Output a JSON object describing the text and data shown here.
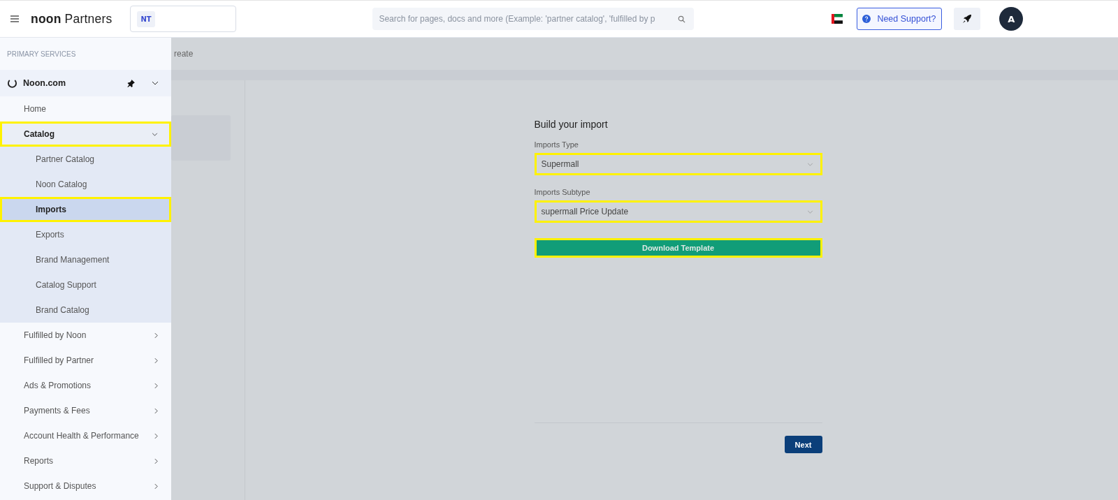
{
  "header": {
    "logo": {
      "brand": "noon",
      "product": "Partners"
    },
    "store_badge": "NT",
    "search": {
      "placeholder": "Search for pages, docs and more (Example: 'partner catalog', 'fulfilled by p"
    },
    "support_button": "Need Support?",
    "avatar": "A"
  },
  "breadcrumb": "reate",
  "sidebar": {
    "section": "PRIMARY SERVICES",
    "service": {
      "label": "Noon.com",
      "expanded": true
    },
    "items": [
      {
        "label": "Home",
        "kind": "link",
        "highlighted": false
      },
      {
        "label": "Catalog",
        "kind": "group",
        "expanded": true,
        "highlighted": true,
        "children": [
          {
            "label": "Partner Catalog",
            "selected": false,
            "highlighted": false
          },
          {
            "label": "Noon Catalog",
            "selected": false,
            "highlighted": false
          },
          {
            "label": "Imports",
            "selected": true,
            "highlighted": true
          },
          {
            "label": "Exports",
            "selected": false,
            "highlighted": false
          },
          {
            "label": "Brand Management",
            "selected": false,
            "highlighted": false
          },
          {
            "label": "Catalog Support",
            "selected": false,
            "highlighted": false
          },
          {
            "label": "Brand Catalog",
            "selected": false,
            "highlighted": false
          }
        ]
      },
      {
        "label": "Fulfilled by Noon",
        "kind": "group",
        "expanded": false,
        "highlighted": false
      },
      {
        "label": "Fulfilled by Partner",
        "kind": "group",
        "expanded": false,
        "highlighted": false
      },
      {
        "label": "Ads & Promotions",
        "kind": "group",
        "expanded": false,
        "highlighted": false
      },
      {
        "label": "Payments & Fees",
        "kind": "group",
        "expanded": false,
        "highlighted": false
      },
      {
        "label": "Account Health & Performance",
        "kind": "group",
        "expanded": false,
        "highlighted": false
      },
      {
        "label": "Reports",
        "kind": "group",
        "expanded": false,
        "highlighted": false
      },
      {
        "label": "Support & Disputes",
        "kind": "group",
        "expanded": false,
        "highlighted": false
      }
    ]
  },
  "form": {
    "title": "Build your import",
    "fields": [
      {
        "label": "Imports Type",
        "value": "Supermall",
        "highlighted": true
      },
      {
        "label": "Imports Subtype",
        "value": "supermall Price Update",
        "highlighted": true
      }
    ],
    "download_button": {
      "label": "Download Template",
      "highlighted": true
    },
    "next_button": "Next"
  }
}
